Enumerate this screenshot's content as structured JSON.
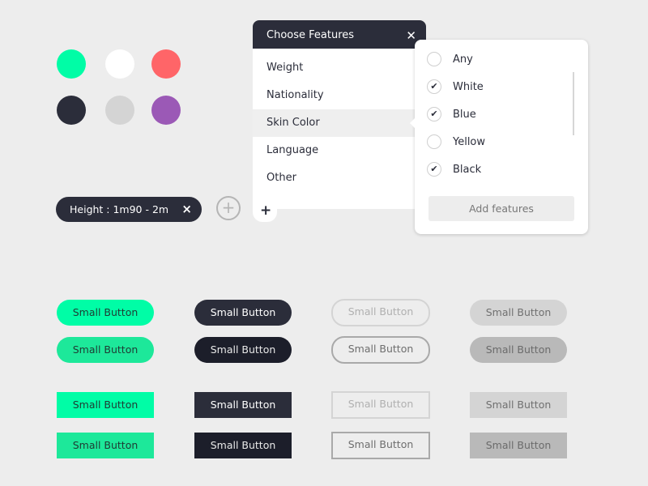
{
  "palette": {
    "swatches": [
      {
        "name": "mint",
        "color": "#00fda6"
      },
      {
        "name": "white",
        "color": "#ffffff"
      },
      {
        "name": "coral",
        "color": "#ff6568"
      },
      {
        "name": "navy",
        "color": "#2b2d3a"
      },
      {
        "name": "light-gray",
        "color": "#d4d4d4"
      },
      {
        "name": "purple",
        "color": "#9b59b6"
      }
    ]
  },
  "filter_chip": {
    "label": "Height : 1m90 - 2m",
    "remove_icon": "×"
  },
  "add_filter_icon": "+",
  "dropdown": {
    "title": "Choose Features",
    "close_icon": "✕",
    "items": [
      {
        "label": "Weight",
        "active": false
      },
      {
        "label": "Nationality",
        "active": false
      },
      {
        "label": "Skin Color",
        "active": true
      },
      {
        "label": "Language",
        "active": false
      },
      {
        "label": "Other",
        "active": false
      }
    ],
    "add_icon": "+"
  },
  "subpanel": {
    "options": [
      {
        "label": "Any",
        "checked": false
      },
      {
        "label": "White",
        "checked": true
      },
      {
        "label": "Blue",
        "checked": true
      },
      {
        "label": "Yellow",
        "checked": false
      },
      {
        "label": "Black",
        "checked": true
      }
    ],
    "check_icon": "✔",
    "button_label": "Add features"
  },
  "buttons": {
    "label": "Small Button",
    "rows": [
      [
        "Small Button",
        "Small Button",
        "Small Button",
        "Small Button"
      ],
      [
        "Small Button",
        "Small Button",
        "Small Button",
        "Small Button"
      ],
      [
        "Small Button",
        "Small Button",
        "Small Button",
        "Small Button"
      ],
      [
        "Small Button",
        "Small Button",
        "Small Button",
        "Small Button"
      ]
    ]
  }
}
